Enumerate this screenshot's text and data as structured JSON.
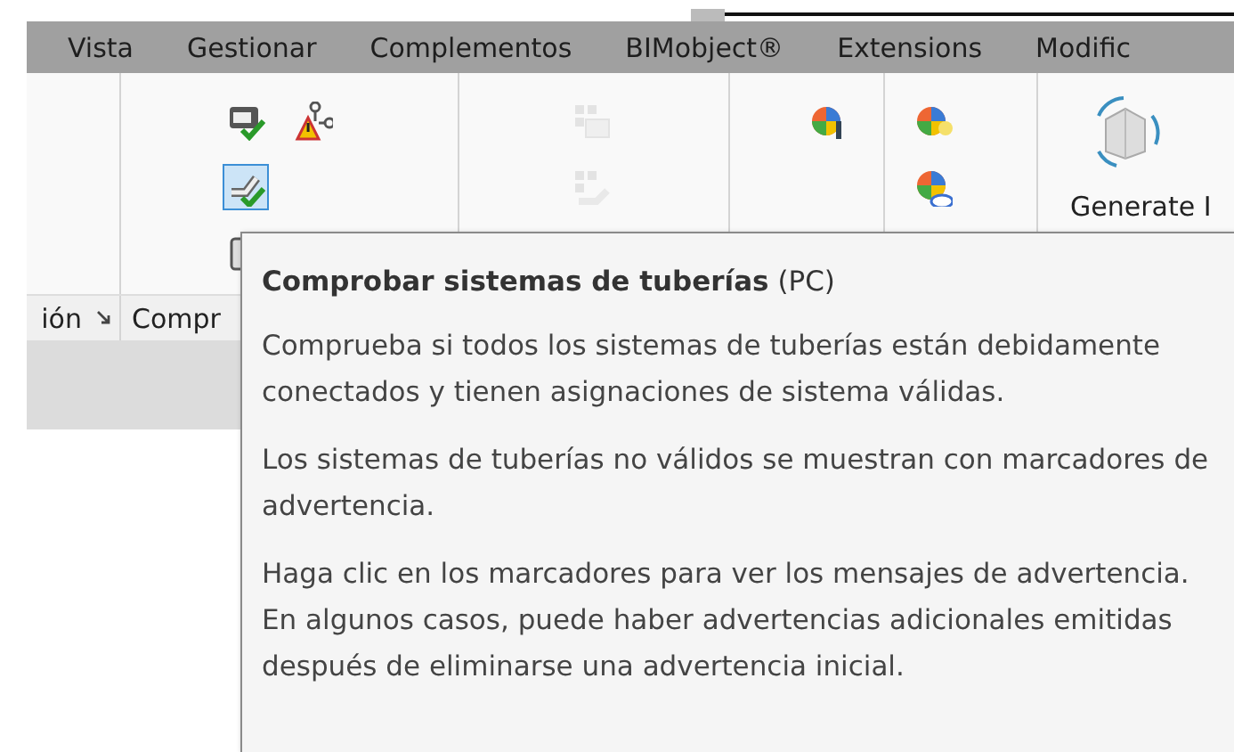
{
  "menu": [
    {
      "label": "Vista"
    },
    {
      "label": "Gestionar"
    },
    {
      "label": "Complementos"
    },
    {
      "label": "BIMobject®"
    },
    {
      "label": "Extensions"
    },
    {
      "label": "Modific"
    }
  ],
  "ribbon": {
    "panels": [
      {
        "label": "ión",
        "launcher": true
      },
      {
        "label": "Compr",
        "rows": [
          [
            {
              "kind": "check-device",
              "selected": false,
              "disabled": false
            },
            {
              "kind": "warning-network",
              "selected": false,
              "disabled": false
            }
          ],
          [
            {
              "kind": "pipe-check",
              "selected": true,
              "disabled": false
            }
          ],
          [
            {
              "kind": "device",
              "selected": false,
              "disabled": false
            }
          ]
        ]
      },
      {
        "rows": [
          [
            {
              "kind": "grid-box",
              "selected": false,
              "disabled": true
            }
          ],
          [
            {
              "kind": "grid-pipe",
              "selected": false,
              "disabled": true
            }
          ]
        ]
      },
      {
        "rows": [
          [
            {
              "kind": "wheel-wrench",
              "selected": false,
              "disabled": false
            }
          ]
        ]
      },
      {
        "rows": [
          [
            {
              "kind": "wheel-bulb",
              "selected": false,
              "disabled": false
            }
          ],
          [
            {
              "kind": "wheel-cloud",
              "selected": false,
              "disabled": false
            }
          ]
        ]
      },
      {
        "large": {
          "kind": "rotate-box",
          "label": "Generate I"
        }
      }
    ]
  },
  "tooltip": {
    "title": "**Comprobar sistemas de tuberías** (PC)",
    "paragraphs": [
      "Comprueba si todos los sistemas de tuberías están debidamente conectados y tienen asignaciones de sistema válidas.",
      "Los sistemas de tuberías no válidos se muestran con marcadores de advertencia.",
      "Haga clic en los marcadores para ver los mensajes de advertencia. En algunos casos, puede haber advertencias adicionales emitidas después de eliminarse una advertencia inicial."
    ]
  }
}
